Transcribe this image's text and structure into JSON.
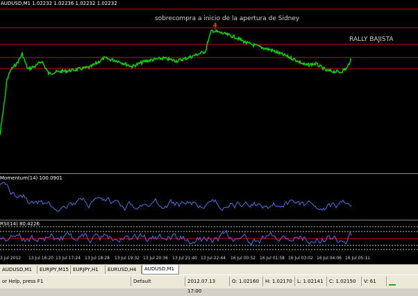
{
  "main_chart": {
    "header": "AUDUSD,M1  1.02232 1.02236 1.02232 1.02232",
    "annotation": "sobrecompra a inicio de la apertura de Sidney",
    "label_right": "RALLY BAJISTA",
    "marker": "4"
  },
  "momentum": {
    "label": "Momentum(14) 100.0901"
  },
  "rsi": {
    "label": "RSI(14) 80.4226"
  },
  "time_axis": {
    "labels": [
      "3 Jul 2012",
      "13 Jul 16:20",
      "13 Jul 17:24",
      "13 Jul 18:28",
      "13 Jul 19:32",
      "13 Jul 20:36",
      "13 Jul 21:40",
      "13 Jul 22:44",
      "16 Jul 00:52",
      "16 Jul 01:58",
      "16 Jul 03:02",
      "16 Jul 04:06",
      "16 Jul 05:11"
    ]
  },
  "tabs": [
    {
      "label": "AUDUSD,M1",
      "active": false
    },
    {
      "label": "EURJPY,M15",
      "active": false
    },
    {
      "label": "EURJPY,H1",
      "active": false
    },
    {
      "label": "EURUSD,H4",
      "active": false
    },
    {
      "label": "AUDUSD,M1",
      "active": true
    }
  ],
  "status": {
    "help": "or Help, press F1",
    "profile": "Default",
    "datetime": "2012.07.13 17:00",
    "open": "O: 1.02160",
    "high": "H: 1.02170",
    "low": "L: 1.02141",
    "close": "C: 1.02150",
    "volume": "V: 61"
  },
  "colors": {
    "price_line": "#00e000",
    "indicator_line": "#4a74e8",
    "level_line": "#d00000",
    "background": "#000000",
    "grid_text": "#d8d8d8"
  }
}
